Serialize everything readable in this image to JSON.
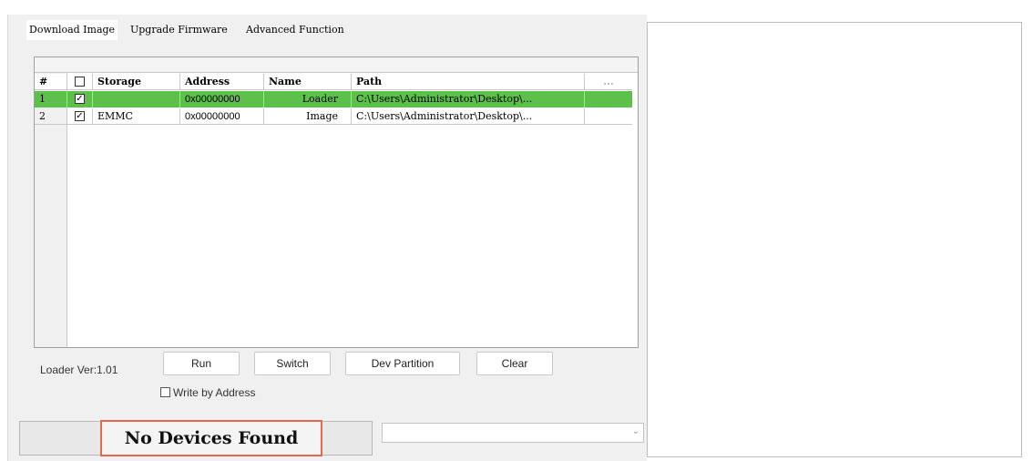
{
  "tabs": [
    {
      "label": "Download Image",
      "active": true
    },
    {
      "label": "Upgrade Firmware",
      "active": false
    },
    {
      "label": "Advanced Function",
      "active": false
    }
  ],
  "table": {
    "columns": [
      "#",
      "",
      "Storage",
      "Address",
      "Name",
      "Path",
      "..."
    ],
    "rows": [
      {
        "num": "1",
        "checked": true,
        "storage": "",
        "address": "0x00000000",
        "name": "Loader",
        "path": "C:\\Users\\Administrator\\Desktop\\...",
        "highlighted": true
      },
      {
        "num": "2",
        "checked": true,
        "storage": "EMMC",
        "address": "0x00000000",
        "name": "Image",
        "path": "C:\\Users\\Administrator\\Desktop\\...",
        "highlighted": false
      }
    ]
  },
  "loader_version": "Loader Ver:1.01",
  "buttons": {
    "run": "Run",
    "switch": "Switch",
    "dev_partition": "Dev Partition",
    "clear": "Clear"
  },
  "write_by_address": {
    "label": "Write by Address",
    "checked": false
  },
  "status": {
    "text": "No Devices Found"
  },
  "combo": {
    "value": ""
  },
  "icons": {
    "combo_arrow": "chevron-down-icon",
    "check": "check-icon"
  },
  "colors": {
    "selected_row": "#5cc04a",
    "status_highlight": "#e06a4a"
  }
}
